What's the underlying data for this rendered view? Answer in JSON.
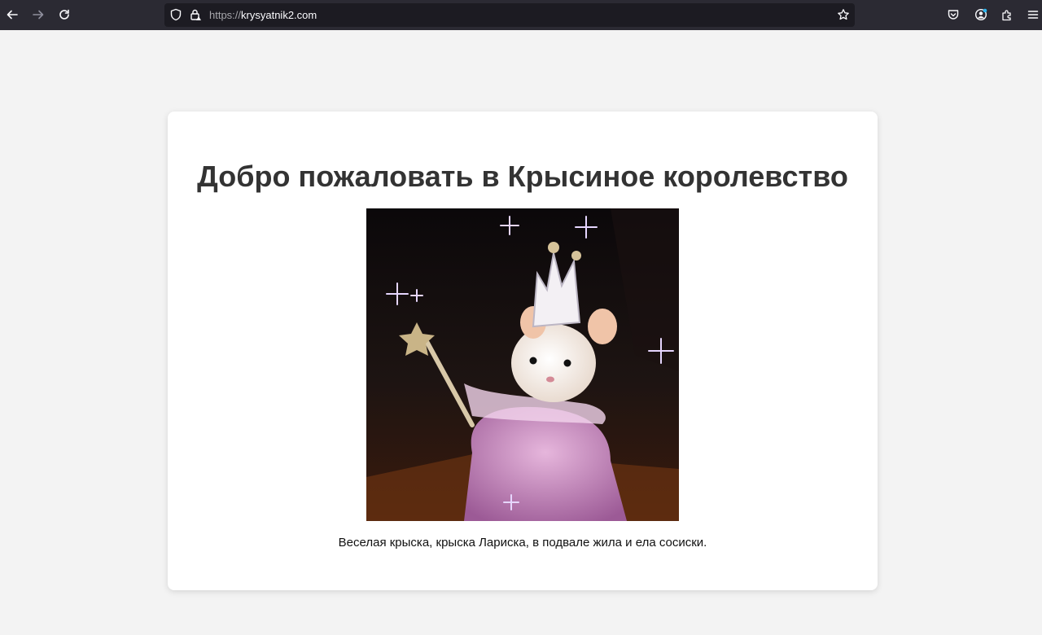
{
  "browser": {
    "url_scheme": "https://",
    "url_host": "krysyatnik2.com",
    "icons": {
      "back": "back-arrow-icon",
      "forward": "forward-arrow-icon",
      "reload": "reload-icon",
      "shield": "shield-icon",
      "lock": "lock-icon",
      "bookmark": "star-icon",
      "pocket": "pocket-icon",
      "account": "account-icon",
      "extensions": "extensions-icon",
      "menu": "hamburger-menu-icon"
    }
  },
  "page": {
    "heading": "Добро пожаловать в Крысиное королевство",
    "image_subject": "white rat dressed as a fairy princess with crown and star wand",
    "caption": "Веселая крыска, крыска Лариска, в подвале жила и ела сосиски."
  },
  "colors": {
    "chrome_bg": "#2b2a33",
    "urlbar_bg": "#1c1b22",
    "page_bg": "#f3f3f3",
    "card_bg": "#ffffff",
    "heading": "#333333"
  }
}
